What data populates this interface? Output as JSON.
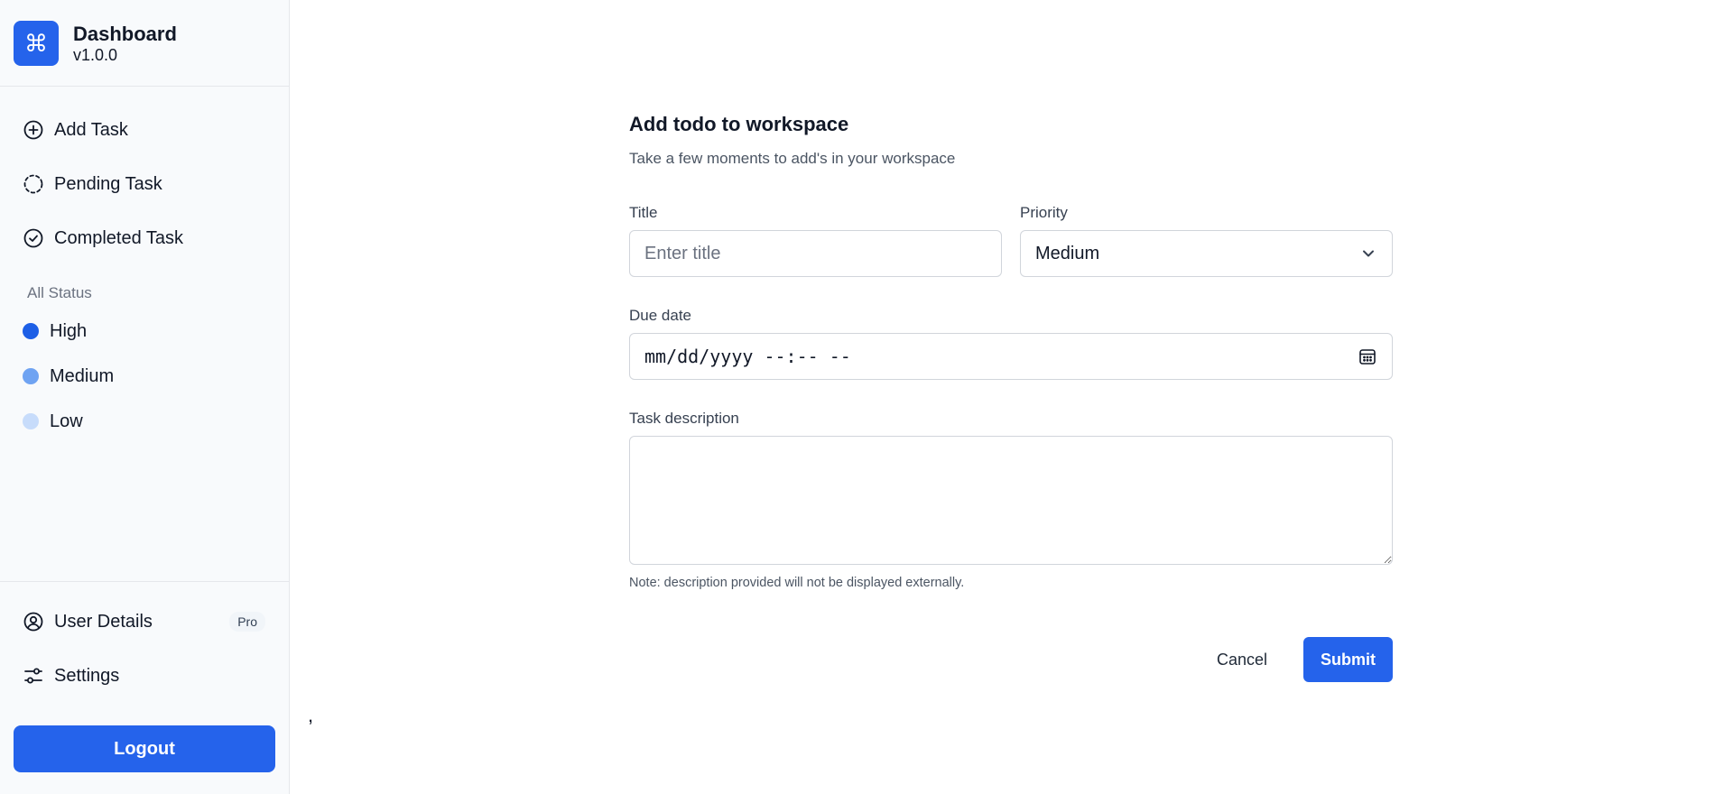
{
  "brand": {
    "logo_glyph": "⌘",
    "title": "Dashboard",
    "version": "v1.0.0",
    "color": "#2563eb"
  },
  "nav": {
    "items": [
      {
        "label": "Add Task",
        "icon": "plus-circle-icon"
      },
      {
        "label": "Pending Task",
        "icon": "dashed-circle-icon"
      },
      {
        "label": "Completed Task",
        "icon": "check-circle-icon"
      }
    ]
  },
  "status": {
    "heading": "All Status",
    "items": [
      {
        "label": "High",
        "color": "#1d5fe6"
      },
      {
        "label": "Medium",
        "color": "#6fa3f2"
      },
      {
        "label": "Low",
        "color": "#c7dcfb"
      }
    ]
  },
  "bottom": {
    "user_details_label": "User Details",
    "user_icon": "user-circle-icon",
    "pro_badge": "Pro",
    "settings_label": "Settings",
    "settings_icon": "sliders-icon",
    "logout_label": "Logout"
  },
  "main": {
    "stray_text": ","
  },
  "form": {
    "title": "Add todo to workspace",
    "subtitle": "Take a few moments to add's in your workspace",
    "title_label": "Title",
    "title_placeholder": "Enter title",
    "priority_label": "Priority",
    "priority_value": "Medium",
    "due_label": "Due date",
    "due_value": "mm/dd/yyyy --:-- --",
    "description_label": "Task description",
    "description_value": "",
    "note": "Note: description provided will not be displayed externally.",
    "cancel_label": "Cancel",
    "submit_label": "Submit"
  }
}
